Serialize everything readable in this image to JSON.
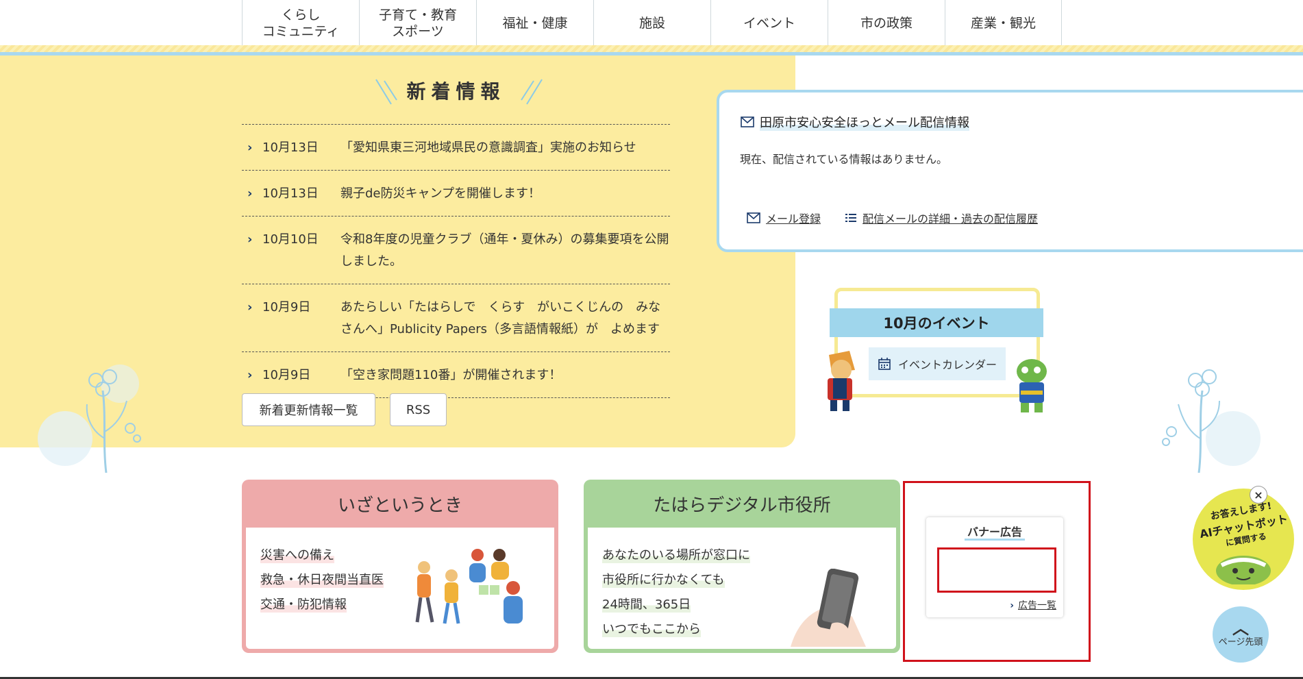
{
  "nav": {
    "items": [
      {
        "line1": "くらし",
        "line2": "コミュニティ"
      },
      {
        "line1": "子育て・教育",
        "line2": "スポーツ"
      },
      {
        "line1": "福祉・健康",
        "line2": ""
      },
      {
        "line1": "施設",
        "line2": ""
      },
      {
        "line1": "イベント",
        "line2": ""
      },
      {
        "line1": "市の政策",
        "line2": ""
      },
      {
        "line1": "産業・観光",
        "line2": ""
      }
    ]
  },
  "news": {
    "title": "新着情報",
    "items": [
      {
        "date": "10月13日",
        "text": "「愛知県東三河地域県民の意識調査」実施のお知らせ"
      },
      {
        "date": "10月13日",
        "text": "親子de防災キャンプを開催します！"
      },
      {
        "date": "10月10日",
        "text": "令和8年度の児童クラブ（通年・夏休み）の募集要項を公開しました。"
      },
      {
        "date": "10月9日",
        "text": "あたらしい「たはらしで　くらす　がいこくじんの　みなさんへ」Publicity Papers（多言語情報紙）が　よめます"
      },
      {
        "date": "10月9日",
        "text": "「空き家問題110番」が開催されます！"
      }
    ],
    "list_button": "新着更新情報一覧",
    "rss_button": "RSS"
  },
  "mail": {
    "title": "田原市安心安全ほっとメール配信情報",
    "status": "現在、配信されている情報はありません。",
    "register_link": "メール登録",
    "history_link": "配信メールの詳細・過去の配信履歴"
  },
  "event": {
    "title": "10月のイベント",
    "calendar_link": "イベントカレンダー"
  },
  "emergency": {
    "title": "いざというとき",
    "links": [
      "災害への備え",
      "救急・休日夜間当直医",
      "交通・防犯情報"
    ]
  },
  "digital": {
    "title": "たはらデジタル市役所",
    "lines": [
      "あなたのいる場所が窓口に",
      "市役所に行かなくても",
      "24時間、365日",
      "いつでもここから"
    ]
  },
  "banner": {
    "title": "バナー広告",
    "more_link": "広告一覧"
  },
  "chatbot": {
    "line1": "お答えします!",
    "line2": "AIチャットボット",
    "line3": "に質問する",
    "close": "×"
  },
  "pagetop": {
    "label": "ページ先頭",
    "arrow": "︿"
  },
  "colors": {
    "yellow_panel": "#fcec9f",
    "light_blue": "#a8d8ef",
    "emergency_head": "#eeaaaa",
    "digital_head": "#a8d49a",
    "banner_border": "#d0121b",
    "chatbot": "#e6e650"
  }
}
